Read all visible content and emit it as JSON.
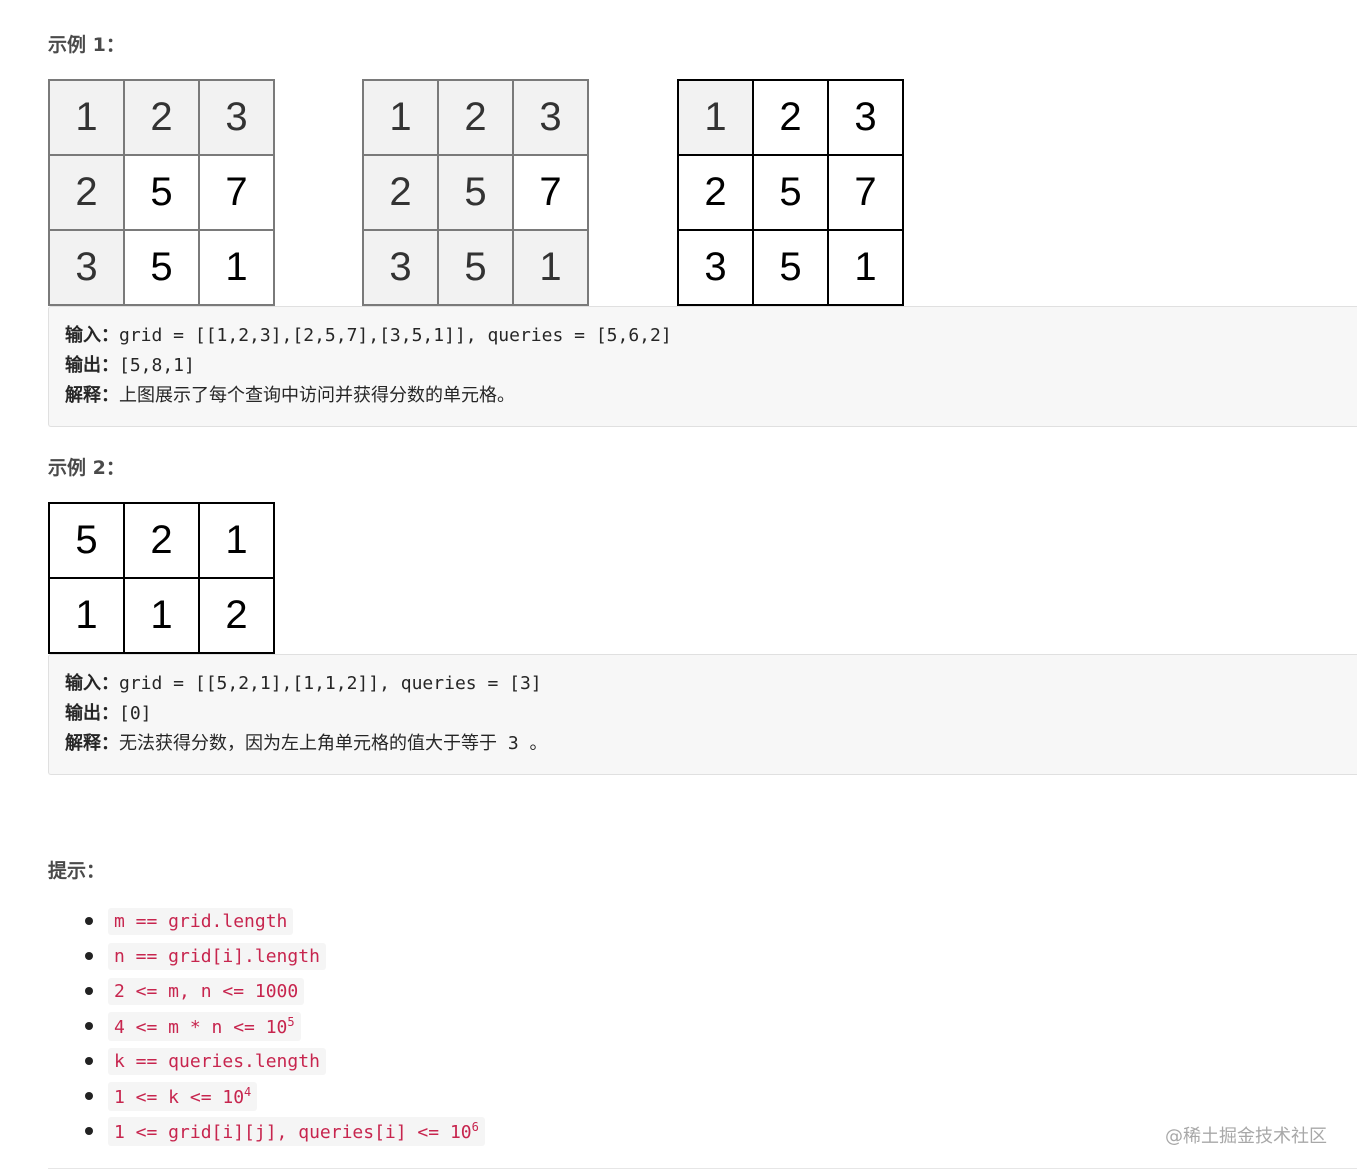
{
  "example1": {
    "heading": "示例 1：",
    "grids": [
      {
        "cells": [
          "1",
          "2",
          "3",
          "2",
          "5",
          "7",
          "3",
          "5",
          "1"
        ],
        "shaded": [
          true,
          true,
          true,
          true,
          false,
          false,
          true,
          false,
          false
        ]
      },
      {
        "cells": [
          "1",
          "2",
          "3",
          "2",
          "5",
          "7",
          "3",
          "5",
          "1"
        ],
        "shaded": [
          true,
          true,
          true,
          true,
          true,
          false,
          true,
          true,
          true
        ]
      },
      {
        "cells": [
          "1",
          "2",
          "3",
          "2",
          "5",
          "7",
          "3",
          "5",
          "1"
        ],
        "shaded": [
          true,
          false,
          false,
          false,
          false,
          false,
          false,
          false,
          false
        ]
      }
    ],
    "input_label": "输入：",
    "input_value": "grid = [[1,2,3],[2,5,7],[3,5,1]], queries = [5,6,2]",
    "output_label": "输出：",
    "output_value": "[5,8,1]",
    "explain_label": "解释：",
    "explain_value": "上图展示了每个查询中访问并获得分数的单元格。"
  },
  "example2": {
    "heading": "示例 2：",
    "grid": {
      "cells": [
        "5",
        "2",
        "1",
        "1",
        "1",
        "2"
      ]
    },
    "input_label": "输入：",
    "input_value": "grid = [[5,2,1],[1,1,2]], queries = [3]",
    "output_label": "输出：",
    "output_value": "[0]",
    "explain_label": "解释：",
    "explain_text": "无法获得分数，因为左上角单元格的值大于等于",
    "explain_code": "3",
    "explain_end": "。"
  },
  "tips": {
    "heading": "提示：",
    "items": [
      {
        "text": "m == grid.length",
        "sup": ""
      },
      {
        "text": "n == grid[i].length",
        "sup": ""
      },
      {
        "text": "2 <= m, n <= 1000",
        "sup": ""
      },
      {
        "text": "4 <= m * n <= 10",
        "sup": "5"
      },
      {
        "text": "k == queries.length",
        "sup": ""
      },
      {
        "text": "1 <= k <= 10",
        "sup": "4"
      },
      {
        "text": "1 <= grid[i][j], queries[i] <= 10",
        "sup": "6"
      }
    ]
  },
  "watermark": "@稀土掘金技术社区"
}
